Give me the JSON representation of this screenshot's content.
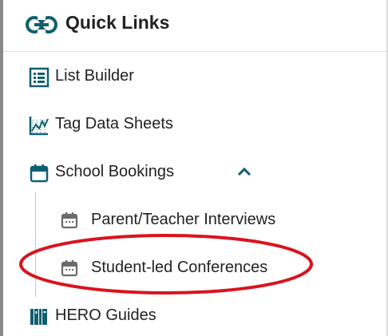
{
  "header": {
    "title": "Quick Links",
    "icon": "link-icon"
  },
  "menu": {
    "list_builder": {
      "label": "List Builder",
      "icon": "list-builder-icon"
    },
    "tag_data_sheets": {
      "label": "Tag Data Sheets",
      "icon": "chart-icon"
    },
    "school_bookings": {
      "label": "School Bookings",
      "icon": "calendar-icon",
      "expanded": true
    },
    "sub_items": [
      {
        "label": "Parent/Teacher Interviews",
        "icon": "calendar-icon"
      },
      {
        "label": "Student-led Conferences",
        "icon": "calendar-icon"
      }
    ],
    "hero_guides": {
      "label": "HERO Guides",
      "icon": "book-icon"
    }
  },
  "colors": {
    "accent": "#0f5f70",
    "sub_icon": "#6b6b6b",
    "annotation": "#d9141e"
  }
}
